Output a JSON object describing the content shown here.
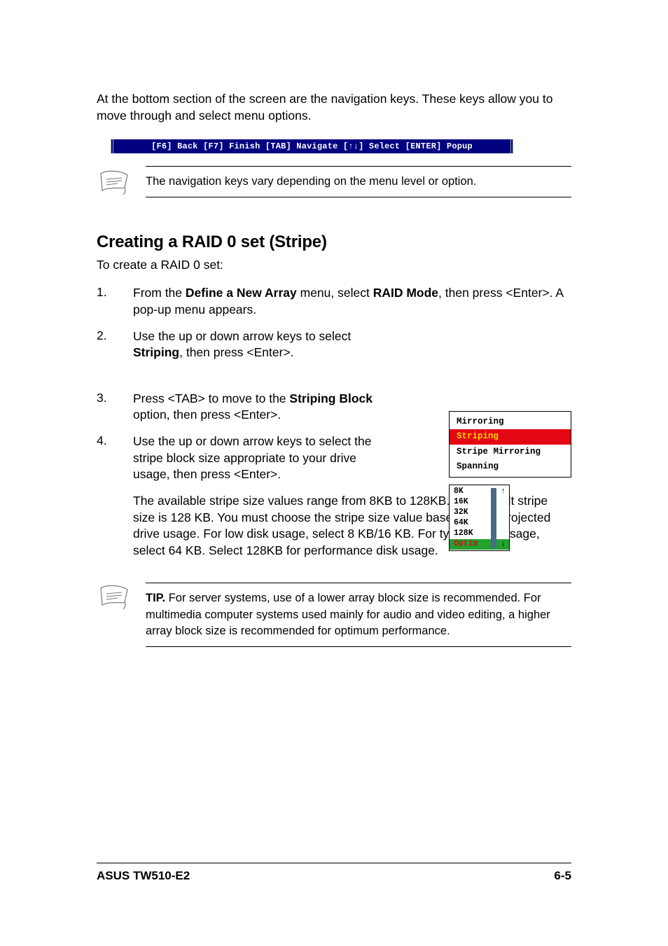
{
  "intro": "At the bottom section of the screen are the navigation keys. These keys allow you to move through and select menu options.",
  "nav_bar": "[F6] Back  [F7] Finish  [TAB] Navigate  [↑↓] Select  [ENTER] Popup",
  "note1": "The navigation keys vary depending on the menu level or option.",
  "heading": "Creating a RAID 0 set (Stripe)",
  "toCreate": "To create a RAID 0 set:",
  "step1_pre": "From the ",
  "step1_bold1": "Define a New Array",
  "step1_mid": " menu, select ",
  "step1_bold2": "RAID Mode",
  "step1_post": ", then press <Enter>. A pop-up menu appears.",
  "step2_pre": "Use the up or down arrow keys to select ",
  "step2_bold": "Striping",
  "step2_post": ", then press <Enter>.",
  "step3_pre": "Press <TAB> to move to the ",
  "step3_bold": "Striping Block",
  "step3_post": " option, then press <Enter>.",
  "step4": "Use the up or down arrow keys to select the stripe block size appropriate to your drive usage, then press <Enter>.",
  "stripe_explain": "The available stripe size values range from 8KB to 128KB. The default stripe size is 128 KB. You must choose the stripe size value based on the projected drive usage. For low disk usage, select 8 KB/16 KB. For typical disk usage, select 64 KB. Select 128KB for performance disk usage.",
  "tip_label": "TIP.",
  "tip_text": " For server systems, use of a lower array block size is recommended. For multimedia computer systems used mainly for audio and video editing, a higher array block size is recommended for optimum performance.",
  "raid_modes": {
    "m0": "Mirroring",
    "m1": "Striping",
    "m2": "Stripe Mirroring",
    "m3": "Spanning"
  },
  "block_sizes": {
    "b0": "8K",
    "b1": "16K",
    "b2": "32K",
    "b3": "64K",
    "b4": "128K",
    "b5": "Optim"
  },
  "footer": {
    "left": "ASUS TW510-E2",
    "right": "6-5"
  },
  "steps": {
    "n1": "1.",
    "n2": "2.",
    "n3": "3.",
    "n4": "4."
  }
}
